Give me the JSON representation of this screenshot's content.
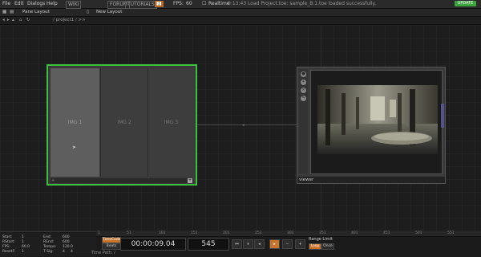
{
  "menu": {
    "file": "File",
    "edit": "Edit",
    "dialogs": "Dialogs",
    "help": "Help",
    "wiki": "WIKI",
    "forum": "FORUM",
    "tutorials": "TUTORIALS",
    "fps_label": "FPS:",
    "fps_value": "60",
    "realtime": "Realtime",
    "status": "0:13:43 Load Project.toe: sample_B.1.toe loaded successfully.",
    "update": "UPDATE"
  },
  "toolbar": {
    "pane_layout": "Pane Layout",
    "new_layout": "New Layout"
  },
  "pathbar": {
    "path": "/ project1 / >>"
  },
  "node": {
    "cells": [
      "IMG 1",
      "IMG 2",
      "IMG 3"
    ],
    "footer_label": "+",
    "add_label": "+"
  },
  "viewer": {
    "label": "viewer",
    "tool_icons": [
      "circle-icon",
      "plus-icon",
      "cross-icon",
      "paint-icon"
    ]
  },
  "timeline": {
    "ruler_ticks": [
      "1",
      "51",
      "101",
      "151",
      "201",
      "251",
      "301",
      "351",
      "401",
      "451",
      "501",
      "551"
    ],
    "stats": {
      "start_label": "Start:",
      "start_value": "1",
      "end_label": "End:",
      "end_value": "600",
      "rstart_label": "RStart:",
      "rstart_value": "1",
      "rend_label": "REnd:",
      "rend_value": "600",
      "fps_label": "FPS:",
      "fps_value": "60.0",
      "tempo_label": "Tempo:",
      "tempo_value": "120.0",
      "resetf_label": "ResetF:",
      "resetf_value": "1",
      "tsig_label": "T Sig:",
      "tsig_value1": "4",
      "tsig_value2": "4"
    },
    "timecode_btn": "TimeCode",
    "beats_btn": "Beats",
    "timecode": "00:00:09.04",
    "frame": "545",
    "range_limit": "Range Limit",
    "loop_btn": "Loop",
    "once_btn": "Once",
    "time_path": "Time Path: /"
  },
  "colors": {
    "selected_node_border": "#3cc13c",
    "accent_orange": "#c7752c",
    "update_green": "#3ca23c"
  }
}
